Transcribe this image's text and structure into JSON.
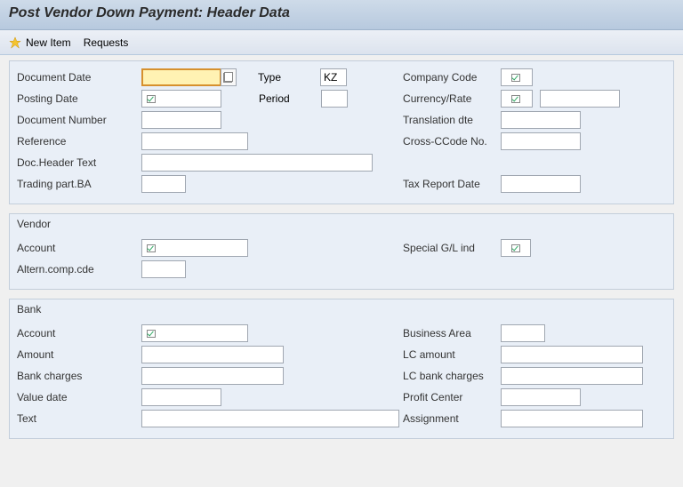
{
  "title": "Post Vendor Down Payment: Header Data",
  "toolbar": {
    "new_item": "New Item",
    "requests": "Requests"
  },
  "header": {
    "doc_date_label": "Document Date",
    "doc_date": "",
    "type_label": "Type",
    "type": "KZ",
    "company_code_label": "Company Code",
    "company_code": "",
    "posting_date_label": "Posting Date",
    "posting_date": "",
    "period_label": "Period",
    "period": "",
    "currency_rate_label": "Currency/Rate",
    "currency": "",
    "rate": "",
    "doc_number_label": "Document Number",
    "doc_number": "",
    "translation_dte_label": "Translation dte",
    "translation_dte": "",
    "reference_label": "Reference",
    "reference": "",
    "cross_ccode_label": "Cross-CCode No.",
    "cross_ccode": "",
    "doc_header_text_label": "Doc.Header Text",
    "doc_header_text": "",
    "trading_part_label": "Trading part.BA",
    "trading_part": "",
    "tax_report_label": "Tax Report Date",
    "tax_report": ""
  },
  "vendor": {
    "title": "Vendor",
    "account_label": "Account",
    "account": "",
    "special_gl_label": "Special G/L ind",
    "special_gl": "",
    "altern_comp_label": "Altern.comp.cde",
    "altern_comp": ""
  },
  "bank": {
    "title": "Bank",
    "account_label": "Account",
    "account": "",
    "business_area_label": "Business Area",
    "business_area": "",
    "amount_label": "Amount",
    "amount": "",
    "lc_amount_label": "LC amount",
    "lc_amount": "",
    "bank_charges_label": "Bank charges",
    "bank_charges": "",
    "lc_bank_charges_label": "LC bank charges",
    "lc_bank_charges": "",
    "value_date_label": "Value date",
    "value_date": "",
    "profit_center_label": "Profit Center",
    "profit_center": "",
    "text_label": "Text",
    "text": "",
    "assignment_label": "Assignment",
    "assignment": ""
  }
}
